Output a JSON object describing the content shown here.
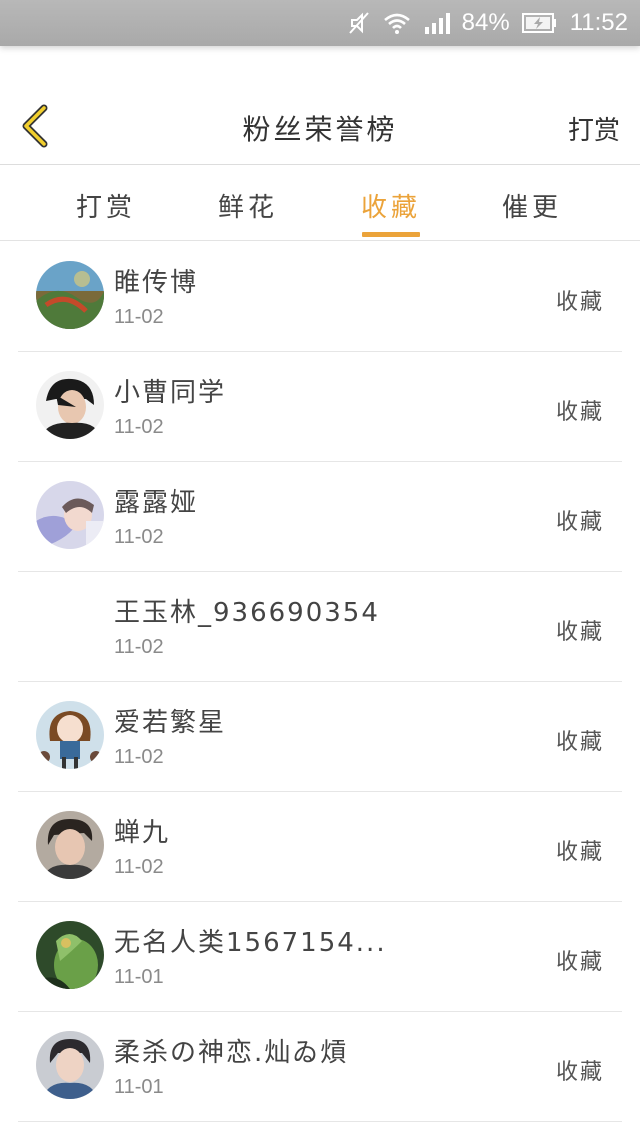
{
  "status_bar": {
    "battery_percent": "84%",
    "time": "11:52"
  },
  "header": {
    "title": "粉丝荣誉榜",
    "right_action": "打赏"
  },
  "tabs": [
    {
      "label": "打赏"
    },
    {
      "label": "鲜花"
    },
    {
      "label": "收藏",
      "active": true
    },
    {
      "label": "催更"
    }
  ],
  "list": [
    {
      "name": "睢传博",
      "date": "11-02",
      "action": "收藏"
    },
    {
      "name": "小曹同学",
      "date": "11-02",
      "action": "收藏"
    },
    {
      "name": "露露娅",
      "date": "11-02",
      "action": "收藏"
    },
    {
      "name": "王玉林_936690354",
      "date": "11-02",
      "action": "收藏"
    },
    {
      "name": "爱若繁星",
      "date": "11-02",
      "action": "收藏"
    },
    {
      "name": "蝉九",
      "date": "11-02",
      "action": "收藏"
    },
    {
      "name": "无名人类1567154...",
      "date": "11-01",
      "action": "收藏"
    },
    {
      "name": "柔杀の神恋.灿ゐ熕",
      "date": "11-01",
      "action": "收藏"
    }
  ],
  "colors": {
    "accent": "#eba33a",
    "status_bar": "#ababab",
    "divider": "#e6e6e6"
  },
  "icons": [
    "mute-icon",
    "wifi-icon",
    "signal-icon",
    "battery-charging-icon",
    "back-chevron-icon"
  ]
}
